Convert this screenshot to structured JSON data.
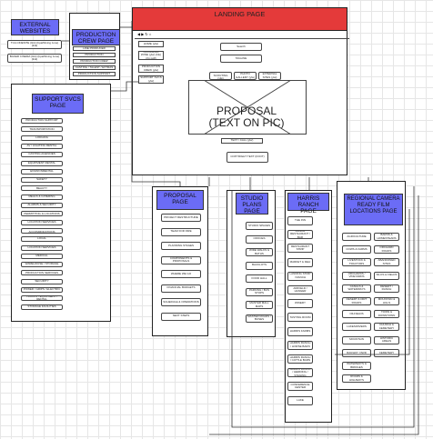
{
  "landing": {
    "title": "LANDING PAGE",
    "nav_icons": "◀ ▶ ↻ ⌂",
    "search_label": "Search",
    "home_label": "HOME (ylw)",
    "links_btn": "CA FILMING ZONE (ylw) (blu) (rtn pg#)",
    "production_crew_btn": "PRODUCTION CREW (ylw)",
    "support_svcs_btn": "SUPPORT SVCS (ylw)",
    "hero_label": "IMAGE",
    "tagline": "TAGLINE",
    "pills": [
      "SET SCOUTING (ylw)",
      "PHOTO GALLERY (ylw)",
      "EXTERNAL SITES (ylw)"
    ],
    "proposal_text_line1": "PROPOSAL",
    "proposal_text_line2": "(TEXT ON PIC)",
    "contact_btn": "TEXT / CALL (ylw)",
    "copyright": "COPYRIGHT TEXT (FOOT)"
  },
  "external": {
    "title": "EXTERNAL WEBSITES",
    "items": [
      "TCA CINESITE (link) (bpa/filming zone) (link)",
      "BAKER CINEMA (link) (bpa/filming zone) (link)"
    ]
  },
  "production_crew": {
    "title": "PRODUCTION CREW PAGE",
    "items": [
      "LINE PRODUCER",
      "PRODUCTION",
      "PRODUCTION CREW",
      "CASTING / TALENT / EXTRAS",
      "PRODUCTION SUPPORT"
    ]
  },
  "support": {
    "title": "SUPPORT SVCS PAGE",
    "items": [
      "PRODUCTION SUPPORT",
      "TRANSPORTATION",
      "LODGING",
      "AV / LIGHTING RENTAL",
      "CASTING AGENCIES",
      "EQUIPMENT RENTAL",
      "ENVIRONMENTAL",
      "SAFETY",
      "BEAUTY",
      "MEALS & CATERING",
      "ALARMS & SECURITY",
      "PERMITTING & LOCATIONS",
      "LOCATION SERVICES",
      "EMERGENCY MEDICAL ACCOMMODATIONS",
      "LOCAL",
      "LOCATION SERVICES",
      "MEDICAL",
      "WAREHOUSE / STORAGE",
      "PRODUCTION SERVICES",
      "SECURITY",
      "POWER / GRIPS / ELECTRIC",
      "TRUCKS / EQUIPMENT / RENTAL",
      "STORAGE FACILITIES"
    ]
  },
  "proposal_page": {
    "title": "PROPOSAL PAGE",
    "items": [
      "PROJECT RESTRUCTURE",
      "TEAM FOR FIRE",
      "PLANNING STAGES",
      "COMPONENTS & PROPOSALS",
      "WHERE WE GO",
      "FINANCIAL BUDGETS",
      "SCHEDULE & OPERATIONS",
      "NEXT STEPS"
    ]
  },
  "studio_plans": {
    "title": "STUDIO PLANS PAGE",
    "items": [
      "STUDIO SPACES",
      "OFFICES",
      "WIDE WALKS & BATHS",
      "BACKLOTS",
      "FOOD HALL",
      "PARKING / BUS STOPS",
      "MASTER MALL MAPS",
      "MASTER ROADS / BUSES"
    ]
  },
  "harris_ranch": {
    "title": "HARRIS RANCH PAGE",
    "items": [
      "THE INN",
      "RANCH RESTAURANT / BAR",
      "RESTAURANT STRIP",
      "MARKET & DELI",
      "LANDING STRIP / RANCH",
      "AIRFIELD / HANGER",
      "WINERY",
      "TASTING ROOM",
      "HARRIS FARMS",
      "HARRIS RANCH / HORSE BARN",
      "HARRIS RANCH / CATTLE BARN",
      "HARRIS RANCH / HERDING / STAGING",
      "CONFERENCE CENTER",
      "LAKE"
    ]
  },
  "regional": {
    "title": "REGIONAL CAMERA READY FILM LOCATIONS PAGE",
    "left_items": [
      "AGRICULTURE",
      "COWS & FARMS",
      "LIVESTOCK & TRACTORS",
      "ORCHARDS / VINEYARDS",
      "CANALS & WATERWAYS",
      "DESERT & DIRT ROADS",
      "OILFIELDS",
      "LAKES/RIVERS",
      "MOUNTAIN",
      "RAILWAY YARD",
      "WATERWAYS & BRIDGES",
      "ROADS & HIGHWAYS"
    ],
    "right_items": [
      "BARNS & HOMESTEADS",
      "ORCHARD ROADS",
      "ABANDONED SITES",
      "SILOS & FIELDS",
      "DESERT / RANCH",
      "MOUNTAIN & HILLS",
      "TOWN & DOWNTOWN",
      "CHURCH & CEMETERY",
      "HISTORIC AREAS",
      "CEMETERY"
    ]
  }
}
